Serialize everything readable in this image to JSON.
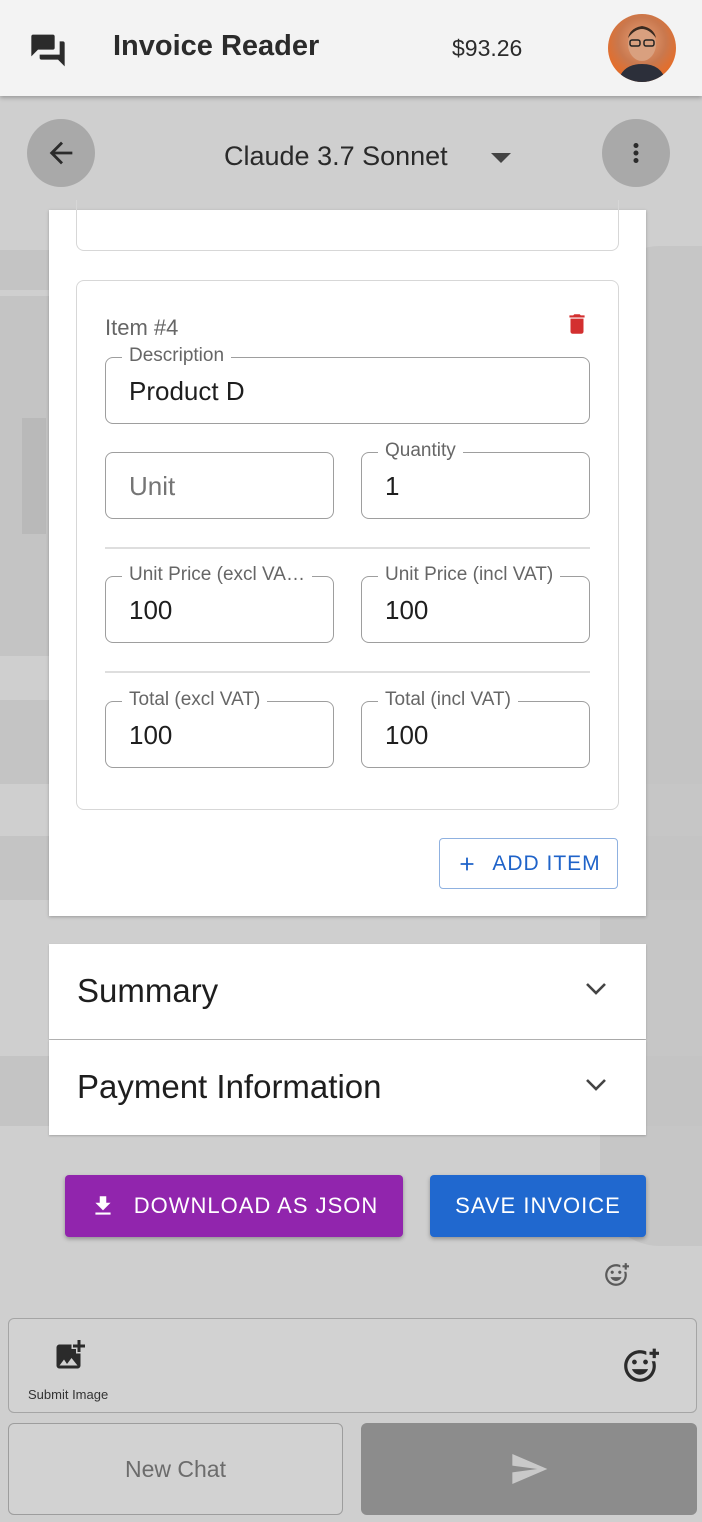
{
  "appbar": {
    "title": "Invoice Reader",
    "balance": "$93.26",
    "chat_icon": "chat-bubbles-icon",
    "avatar": "user-avatar"
  },
  "model_header": {
    "model_name": "Claude 3.7 Sonnet",
    "back_icon": "arrow-left-icon",
    "menu_icon": "more-vert-icon",
    "dropdown_icon": "caret-down-icon"
  },
  "item": {
    "title": "Item #4",
    "delete_icon": "trash-icon",
    "delete_color": "#d32f2f",
    "description": {
      "label": "Description",
      "value": "Product D"
    },
    "unit": {
      "placeholder": "Unit",
      "value": ""
    },
    "quantity": {
      "label": "Quantity",
      "value": "1"
    },
    "unit_price_excl": {
      "label": "Unit Price (excl VA…",
      "value": "100"
    },
    "unit_price_incl": {
      "label": "Unit Price (incl VAT)",
      "value": "100"
    },
    "total_excl": {
      "label": "Total (excl VAT)",
      "value": "100"
    },
    "total_incl": {
      "label": "Total (incl VAT)",
      "value": "100"
    }
  },
  "add_item": {
    "label": "ADD ITEM",
    "icon": "plus-icon"
  },
  "accordions": [
    {
      "title": "Summary",
      "icon": "chevron-down-icon"
    },
    {
      "title": "Payment Information",
      "icon": "chevron-down-icon"
    }
  ],
  "actions": {
    "download_label": "DOWNLOAD AS JSON",
    "download_icon": "download-icon",
    "download_color": "#9125ad",
    "save_label": "SAVE INVOICE",
    "save_color": "#2068cf"
  },
  "chat_input": {
    "submit_image_label": "Submit Image",
    "submit_image_icon": "add-photo-icon",
    "emoji_icon": "add-emoji-icon"
  },
  "bottom_buttons": {
    "new_chat_label": "New Chat",
    "send_icon": "send-icon"
  }
}
